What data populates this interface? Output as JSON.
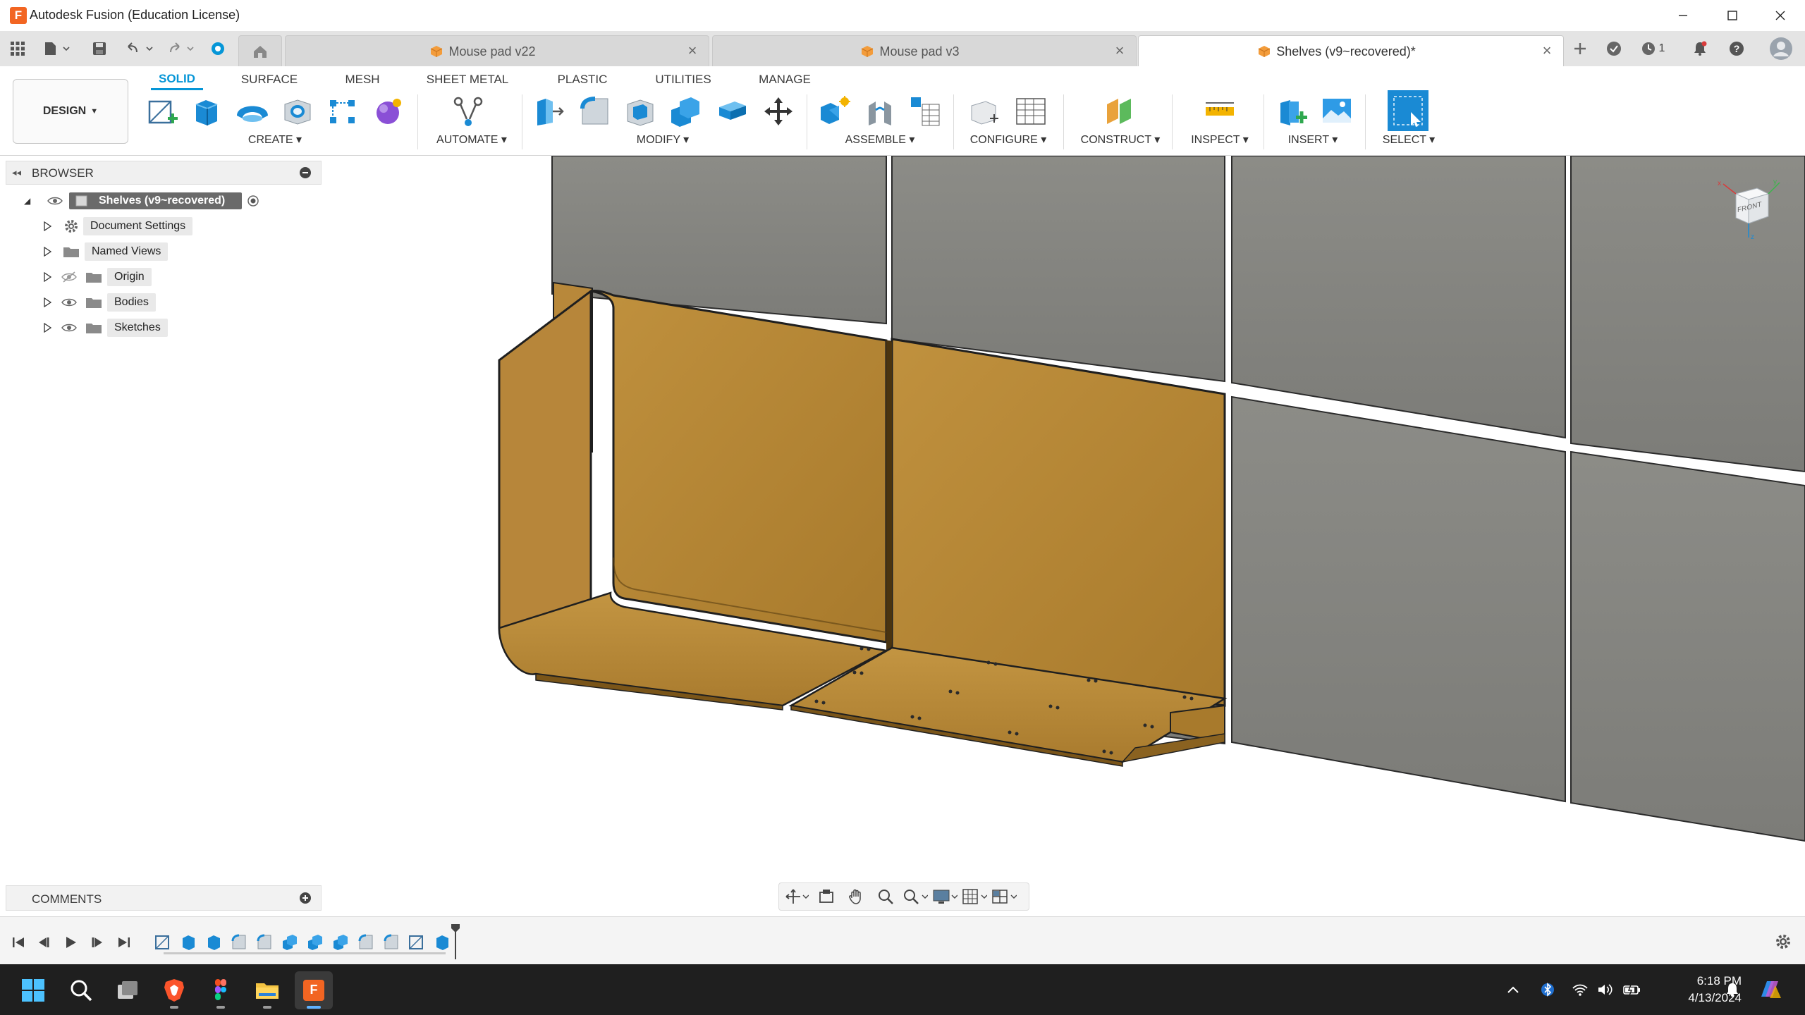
{
  "window": {
    "title": "Autodesk Fusion (Education License)",
    "app_icon_letter": "F"
  },
  "tabs": [
    {
      "label": "Mouse pad v22",
      "active": false
    },
    {
      "label": "Mouse pad v3",
      "active": false
    },
    {
      "label": "Shelves (v9~recovered)*",
      "active": true
    }
  ],
  "header_right": {
    "job_count": "1"
  },
  "toolbar": {
    "workspace_button": "DESIGN",
    "workspace_tabs": [
      "SOLID",
      "SURFACE",
      "MESH",
      "SHEET METAL",
      "PLASTIC",
      "UTILITIES",
      "MANAGE"
    ],
    "active_tab": "SOLID",
    "groups": [
      "CREATE",
      "AUTOMATE",
      "MODIFY",
      "ASSEMBLE",
      "CONFIGURE",
      "CONSTRUCT",
      "INSPECT",
      "INSERT",
      "SELECT"
    ]
  },
  "browser": {
    "title": "BROWSER",
    "root": "Shelves (v9~recovered)",
    "items": [
      "Document Settings",
      "Named Views",
      "Origin",
      "Bodies",
      "Sketches"
    ]
  },
  "viewcube": {
    "face_label": "FRONT"
  },
  "comments": {
    "title": "COMMENTS"
  },
  "taskbar": {
    "time": "6:18 PM",
    "date": "4/13/2024"
  },
  "colors": {
    "accent": "#0696d7",
    "part_fill": "#b9893a",
    "wall_tile": "#858580",
    "taskbar": "#1f1f1f"
  }
}
